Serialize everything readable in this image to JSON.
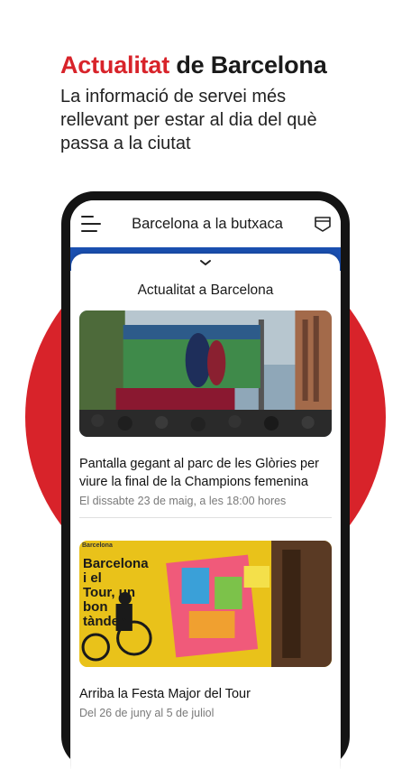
{
  "promo": {
    "title_accent": "Actualitat",
    "title_rest": "de Barcelona",
    "subtitle": "La informació de servei més rellevant per estar al dia del què passa a la ciutat"
  },
  "colors": {
    "brand_red": "#d8232a",
    "header_blue": "#1a4fb0"
  },
  "app": {
    "header_title": "Barcelona a la butxaca",
    "menu_icon": "hamburger-menu-icon",
    "right_icon": "bookmark-ticket-icon"
  },
  "sheet": {
    "handle_icon": "chevron-down-icon",
    "title": "Actualitat a Barcelona"
  },
  "news": [
    {
      "title": "Pantalla gegant al parc de les Glòries per viure la final de la Champions femenina",
      "date": "El dissabte 23 de maig, a les 18:00 hores"
    },
    {
      "title": "Arriba la Festa Major del Tour",
      "date": "Del 26 de juny al 5 de juliol",
      "image_text": "Barcelona i el Tour, un bon tàndem",
      "image_brand": "Barcelona"
    }
  ]
}
